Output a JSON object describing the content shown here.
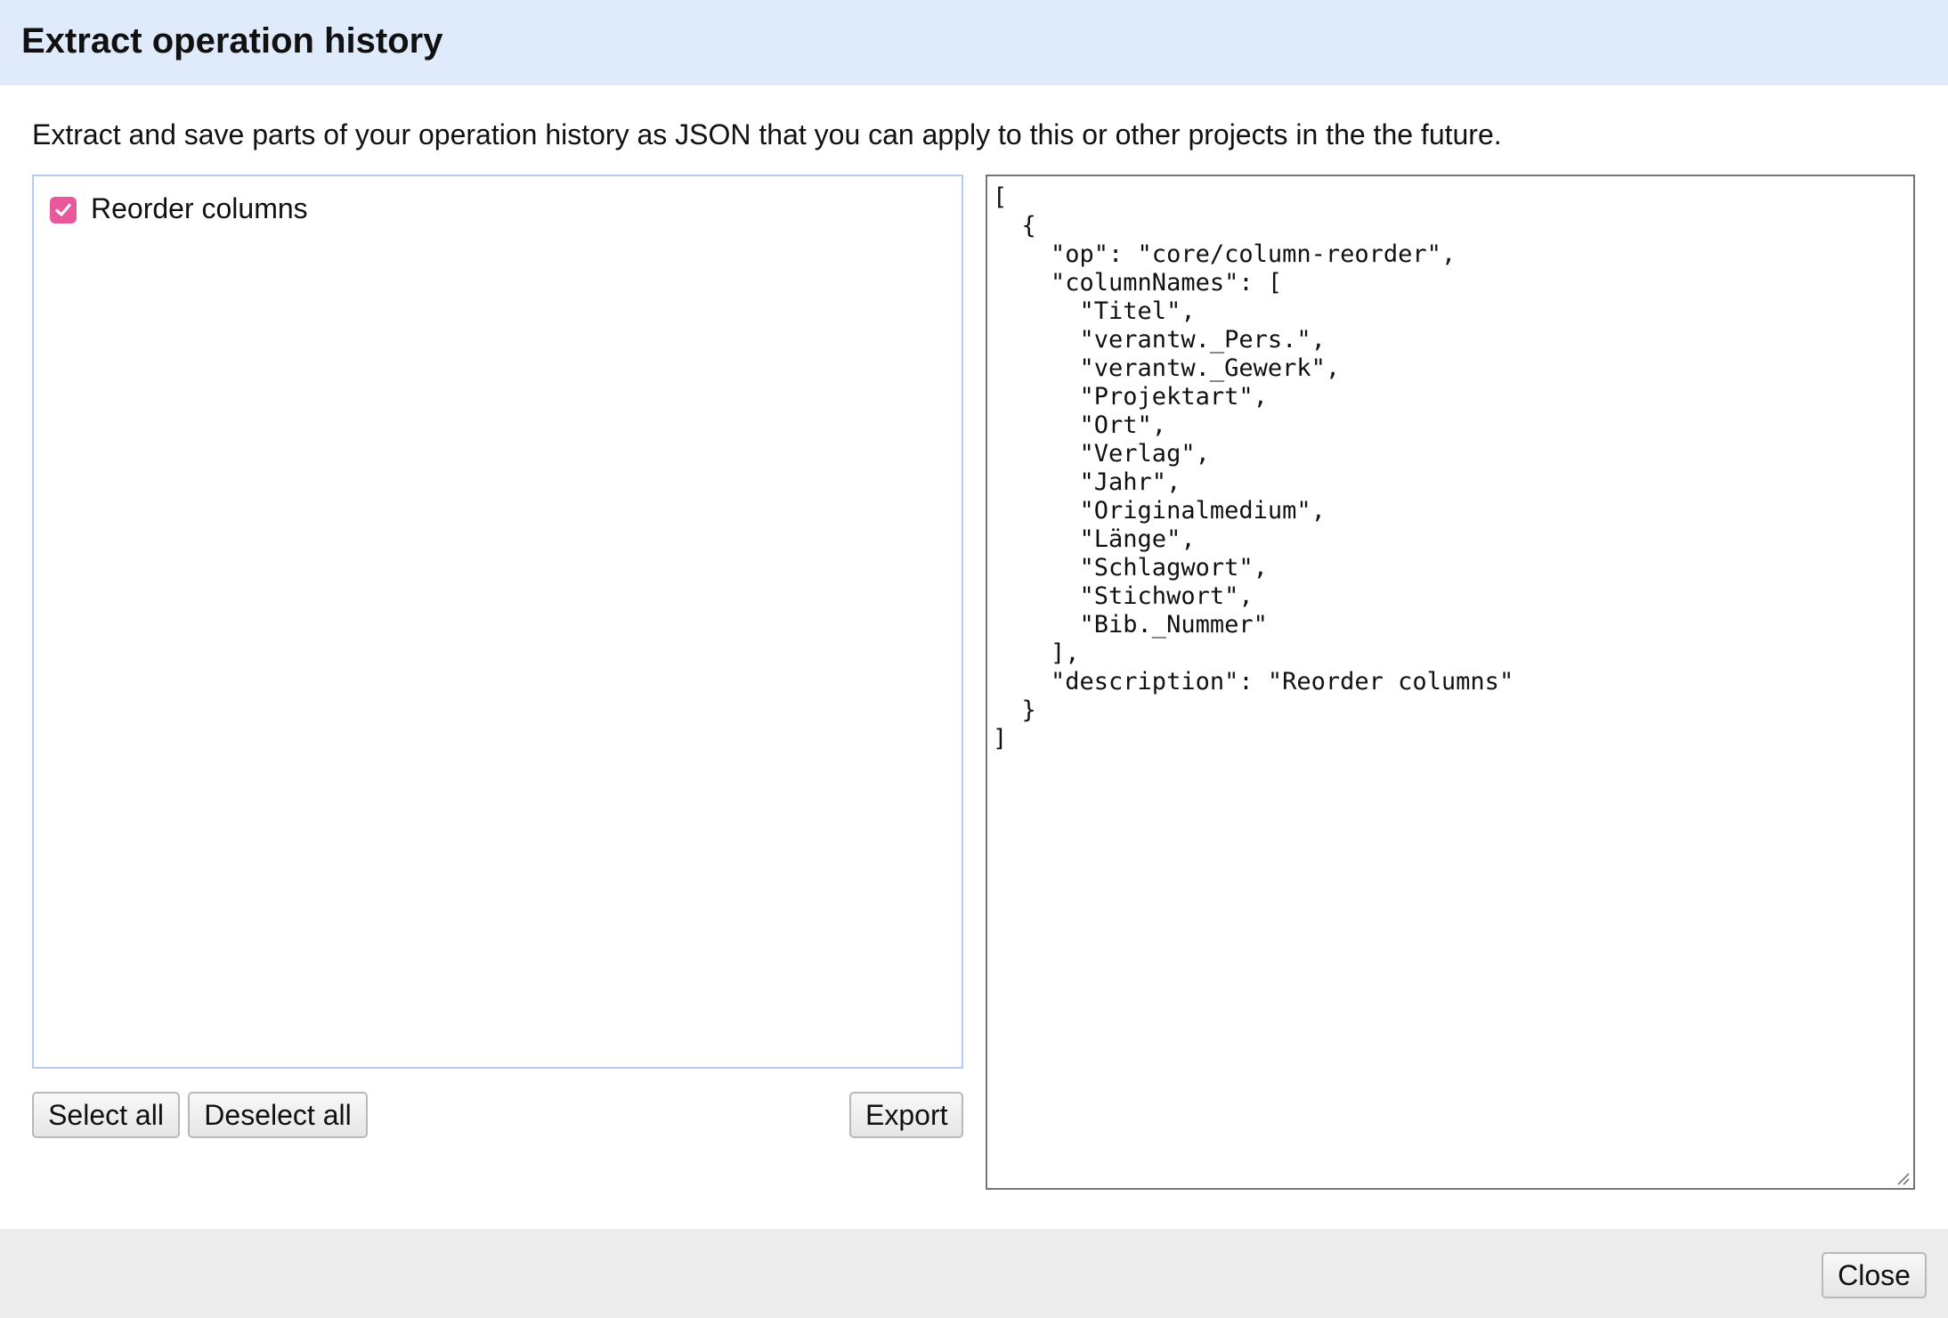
{
  "dialog": {
    "title": "Extract operation history",
    "description": "Extract and save parts of your operation history as JSON that you can apply to this or other projects in the the future."
  },
  "operations": [
    {
      "label": "Reorder columns",
      "checked": true
    }
  ],
  "buttons": {
    "select_all": "Select all",
    "deselect_all": "Deselect all",
    "export": "Export",
    "close": "Close"
  },
  "json_output": "[\n  {\n    \"op\": \"core/column-reorder\",\n    \"columnNames\": [\n      \"Titel\",\n      \"verantw._Pers.\",\n      \"verantw._Gewerk\",\n      \"Projektart\",\n      \"Ort\",\n      \"Verlag\",\n      \"Jahr\",\n      \"Originalmedium\",\n      \"Länge\",\n      \"Schlagwort\",\n      \"Stichwort\",\n      \"Bib._Nummer\"\n    ],\n    \"description\": \"Reorder columns\"\n  }\n]",
  "colors": {
    "header_bg": "#dfeafb",
    "checkbox_accent": "#e9579d",
    "footer_bg": "#ececec",
    "list_border": "#b7caf0"
  }
}
